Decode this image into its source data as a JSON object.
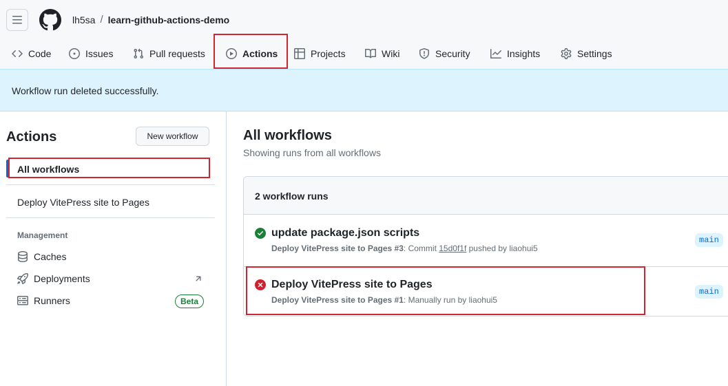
{
  "header": {
    "owner": "lh5sa",
    "separator": "/",
    "repo": "learn-github-actions-demo"
  },
  "tabs": [
    {
      "label": "Code",
      "icon": "code-icon"
    },
    {
      "label": "Issues",
      "icon": "issue-opened-icon"
    },
    {
      "label": "Pull requests",
      "icon": "git-pull-request-icon"
    },
    {
      "label": "Actions",
      "icon": "play-icon",
      "active": true
    },
    {
      "label": "Projects",
      "icon": "table-icon"
    },
    {
      "label": "Wiki",
      "icon": "book-icon"
    },
    {
      "label": "Security",
      "icon": "shield-icon"
    },
    {
      "label": "Insights",
      "icon": "graph-icon"
    },
    {
      "label": "Settings",
      "icon": "gear-icon"
    }
  ],
  "flash": {
    "message": "Workflow run deleted successfully."
  },
  "sidebar": {
    "title": "Actions",
    "new_workflow_label": "New workflow",
    "all_workflows_label": "All workflows",
    "workflows": [
      "Deploy VitePress site to Pages"
    ],
    "management_label": "Management",
    "management_items": [
      {
        "label": "Caches",
        "icon": "database-icon"
      },
      {
        "label": "Deployments",
        "icon": "rocket-icon",
        "trailing_icon": "arrow-up-right-icon"
      },
      {
        "label": "Runners",
        "icon": "server-icon",
        "badge": "Beta"
      }
    ]
  },
  "main": {
    "title": "All workflows",
    "subtitle": "Showing runs from all workflows",
    "runs_count_label": "2 workflow runs",
    "runs": [
      {
        "status": "success",
        "title": "update package.json scripts",
        "workflow": "Deploy VitePress site to Pages",
        "run_number": "#3",
        "trigger_prefix": ": Commit ",
        "commit": "15d0f1f",
        "trigger_suffix": " pushed by liaohui5",
        "branch": "main"
      },
      {
        "status": "failure",
        "title": "Deploy VitePress site to Pages",
        "workflow": "Deploy VitePress site to Pages",
        "run_number": "#1",
        "trigger_prefix": ": Manually run by liaohui5",
        "commit": "",
        "trigger_suffix": "",
        "branch": "main"
      }
    ]
  },
  "colors": {
    "accent": "#0969da",
    "success": "#1a7f37",
    "danger": "#cf222e",
    "highlight_box": "#d1242f",
    "flash_bg": "#ddf4ff"
  }
}
